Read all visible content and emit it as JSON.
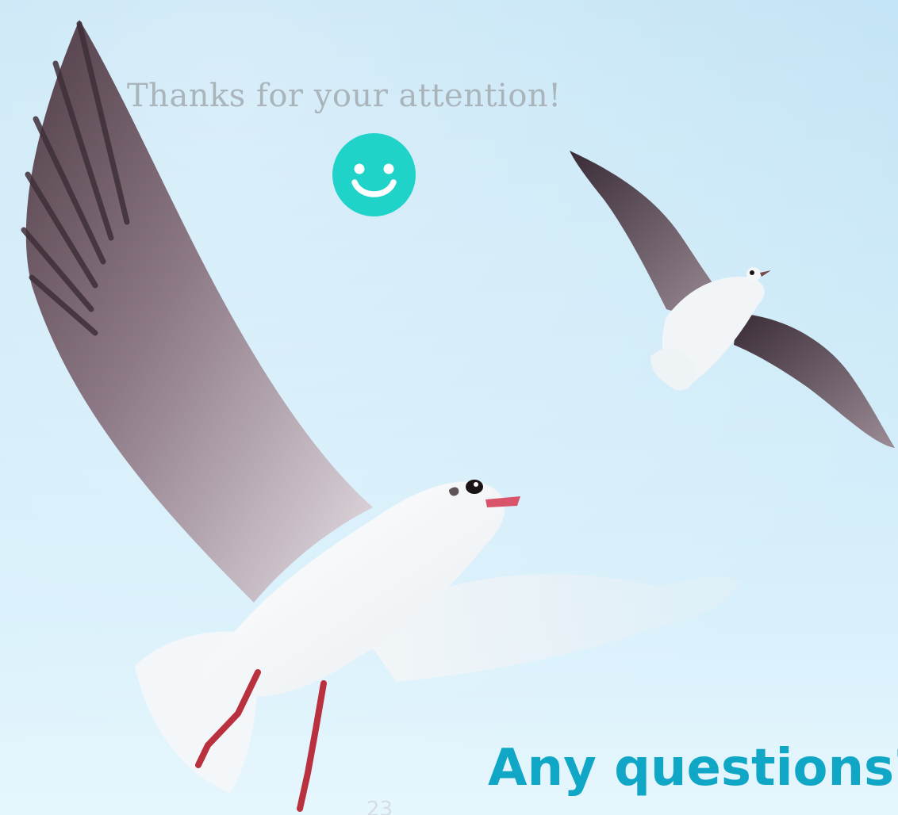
{
  "slide": {
    "thanks_text": "Thanks for your attention!",
    "questions_text": "Any questions?",
    "page_number": "23"
  },
  "icons": {
    "smiley": "smiley-face-icon"
  },
  "colors": {
    "sky": "#cdeaf8",
    "accent": "#1fd3c9",
    "question_text": "#10a6c6",
    "thanks_text": "#a9b4bb"
  }
}
